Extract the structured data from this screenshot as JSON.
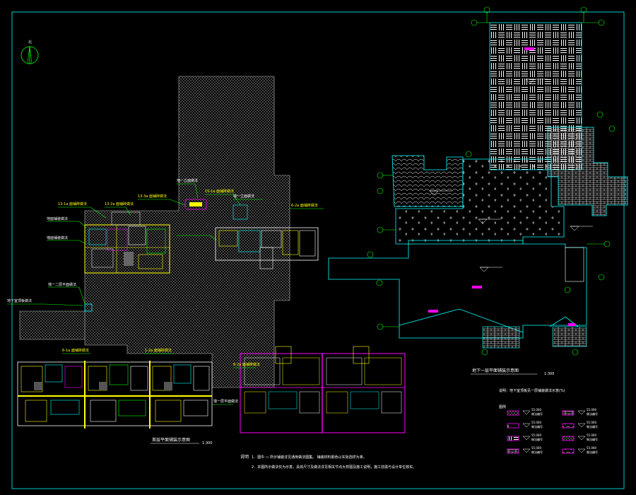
{
  "north_label": "北",
  "left_plan": {
    "title": "首层平面铺装示意图",
    "scale": "1:300",
    "callouts": [
      "13-1a 面铺砖做法",
      "13-2a 面铺砖做法",
      "13-3a 面铺砖做法",
      "15-1a 面铺砖做法",
      "6-2a 面铺砖做法",
      "1-2a 面铺砖做法",
      "6-1a 面铺砖做法",
      "6-2a 面铺砖做法"
    ],
    "side_callouts": [
      "地面铺装做法",
      "墙面铺装做法",
      "墙一立面做法",
      "墙一立面做法",
      "墙一二层平面做法",
      "地下室顶板做法",
      "墙一层平面做法"
    ]
  },
  "right_plan": {
    "title": "地下一层平面铺装示意图",
    "scale": "1:300",
    "subtitle": "说明：地下室顶板见一层铺装做法示意(%)"
  },
  "notes": {
    "label": "说明",
    "lines": [
      "1．图中 ▭ 所示铺装详见通用做法图集。    铺装材料颜色以实际选样为准。",
      "2．本图所示做法仅为示意，具体尺寸及做法详见相关节点大样图及施工说明，施工前需与设计单位核实。"
    ]
  },
  "legend": {
    "label": "图例",
    "items": [
      {
        "code": "55.000",
        "label": "做法编号"
      },
      {
        "code": "55.000",
        "label": "做法编号"
      },
      {
        "code": "55.000",
        "label": "做法编号"
      },
      {
        "code": "55.000",
        "label": "做法编号"
      },
      {
        "code": "55.000",
        "label": "做法编号"
      },
      {
        "code": "55.000",
        "label": "做法编号"
      },
      {
        "code": "55.000",
        "label": "做法编号"
      },
      {
        "code": "55.000",
        "label": "做法编号"
      }
    ]
  },
  "colors": {
    "frame": "#00ffff",
    "callout": "#00ff00",
    "wall": "#ffff00",
    "highlight": "#ff00ff",
    "hatch": "#9a9a9a"
  }
}
